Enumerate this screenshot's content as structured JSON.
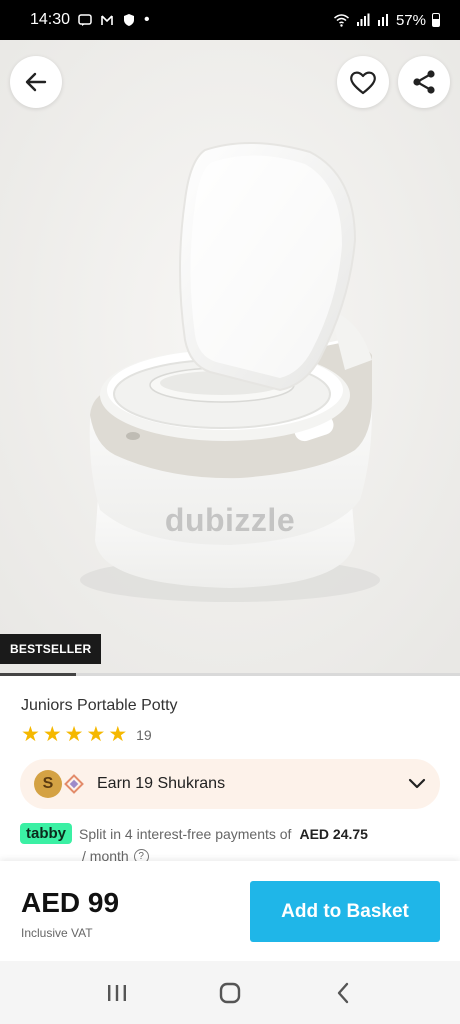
{
  "status_bar": {
    "time": "14:30",
    "battery": "57%"
  },
  "product": {
    "watermark": "dubizzle",
    "badge": "BESTSELLER",
    "image_progress": 0.165,
    "title": "Juniors Portable Potty",
    "rating": 5,
    "rating_count": "19"
  },
  "shukran": {
    "coin_letter": "S",
    "text": "Earn 19 Shukrans"
  },
  "tabby": {
    "badge": "tabby",
    "text": "Split in 4 interest-free payments of",
    "amount": "AED 24.75",
    "per_month": "/ month",
    "info_symbol": "?"
  },
  "purchase": {
    "price": "AED 99",
    "vat_note": "Inclusive VAT",
    "button_label": "Add to Basket"
  },
  "colors": {
    "accent": "#1fb6e8",
    "star": "#f5b800",
    "tabby": "#3bf0a4"
  },
  "icons": [
    "back-arrow-icon",
    "heart-icon",
    "share-icon",
    "chevron-down-icon",
    "info-icon",
    "recents-icon",
    "home-icon",
    "back-nav-icon"
  ]
}
